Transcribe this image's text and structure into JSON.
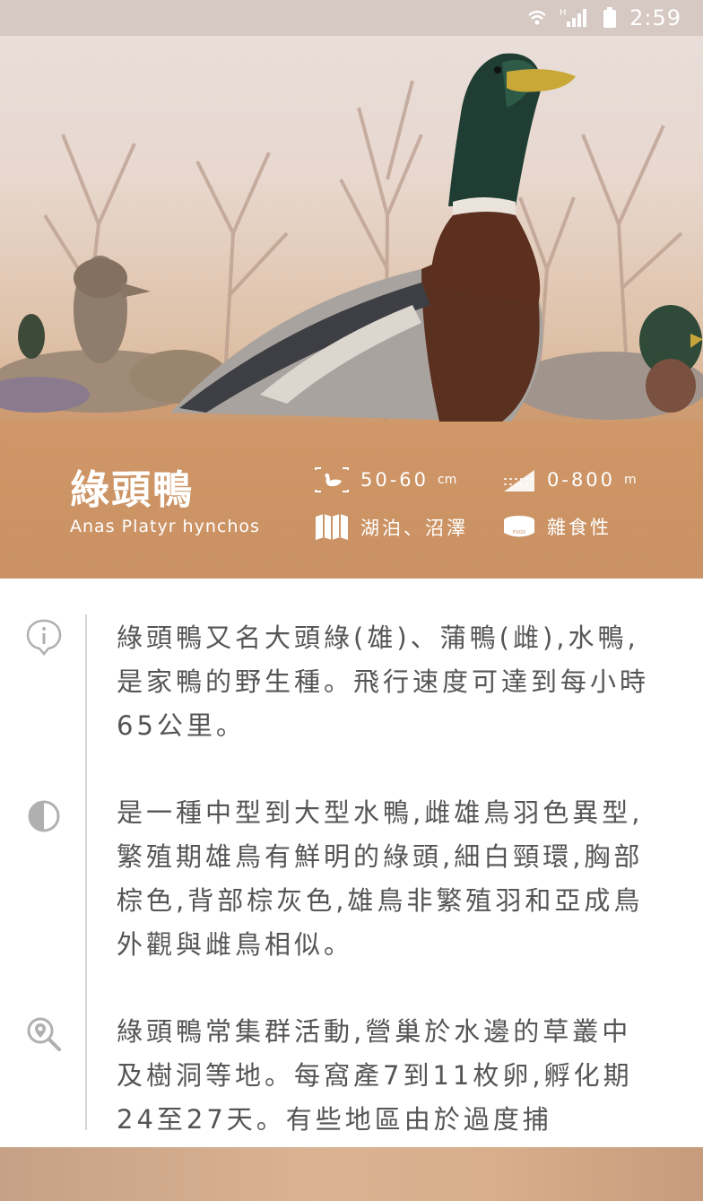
{
  "status_bar": {
    "time": "2:59",
    "network": "H"
  },
  "species": {
    "name_zh": "綠頭鴨",
    "name_en": "Anas Platyr hynchos"
  },
  "facts": {
    "size": {
      "value": "50-60",
      "unit": "cm",
      "icon": "bird-size-icon"
    },
    "altitude": {
      "value": "0-800",
      "unit": "m",
      "icon": "altitude-icon"
    },
    "habitat": {
      "value": "湖泊、沼澤",
      "icon": "map-icon"
    },
    "diet": {
      "value": "雜食性",
      "icon": "food-icon",
      "icon_label": "FOOD"
    }
  },
  "sections": [
    {
      "icon": "info-icon",
      "text": "綠頭鴨又名大頭綠(雄)、蒲鴨(雌),水鴨,是家鴨的野生種。飛行速度可達到每小時65公里。"
    },
    {
      "icon": "contrast-icon",
      "text": "是一種中型到大型水鴨,雌雄鳥羽色異型,繁殖期雄鳥有鮮明的綠頭,細白頸環,胸部棕色,背部棕灰色,雄鳥非繁殖羽和亞成鳥外觀與雌鳥相似。"
    },
    {
      "icon": "location-search-icon",
      "text": "綠頭鴨常集群活動,營巢於水邊的草叢中及樹洞等地。每窩產7到11枚卵,孵化期24至27天。有些地區由於過度捕"
    }
  ],
  "colors": {
    "accent": "#d29a68",
    "text": "#555555",
    "timeline": "#d4d4d4"
  }
}
